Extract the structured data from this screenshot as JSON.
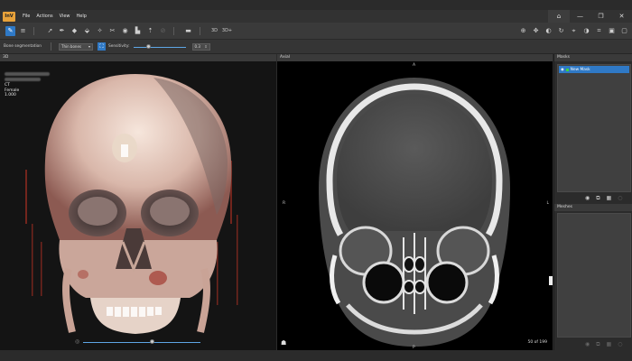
{
  "app": {
    "logo_text": "InV",
    "menu": [
      "File",
      "Actions",
      "View",
      "Help"
    ],
    "window_controls": {
      "home": "⌂",
      "minimize": "—",
      "restore": "❐",
      "close": "✕"
    }
  },
  "toolbar": {
    "left_icons": [
      "brush-tool-icon",
      "layers-icon",
      "select-arrow-icon",
      "pen-icon",
      "eraser-icon",
      "fill-icon",
      "magic-wand-icon",
      "cut-icon",
      "threshold-icon",
      "histogram-icon",
      "export-icon",
      "disabled-icon",
      "minus-icon",
      "3d-icon",
      "3d-plus-icon"
    ],
    "right_icons": [
      "zoom-icon",
      "pan-icon",
      "contrast-icon",
      "reset-icon",
      "target-icon",
      "brightness-icon",
      "crop-icon",
      "layout-icon",
      "screenshot-icon"
    ]
  },
  "options_bar": {
    "tool_label": "Bone segmentation",
    "preset_value": "Thin bones",
    "sensitivity_label": "Sensitivity:",
    "sensitivity_value": "0.3",
    "sensitivity_fraction": 0.3
  },
  "view_3d": {
    "label": "3D",
    "patient_modality": "CT",
    "patient_sex": "Female",
    "patient_value": "1.000"
  },
  "view_axial": {
    "label": "Axial",
    "orient_top": "A",
    "orient_left": "R",
    "orient_right": "L",
    "orient_bottom": "P",
    "slice_counter": "50 of 199"
  },
  "masks_panel": {
    "title": "Masks",
    "items": [
      {
        "name": "New Mask",
        "color": "#3fd13f"
      }
    ]
  },
  "meshes_panel": {
    "title": "Meshes"
  },
  "colors": {
    "accent": "#2f79c6",
    "logo": "#e8a23a",
    "mask_green": "#3fd13f"
  }
}
